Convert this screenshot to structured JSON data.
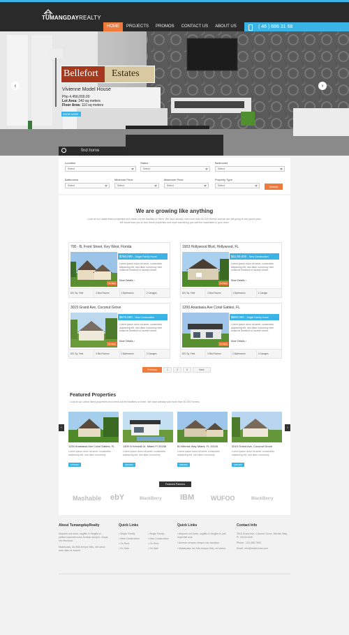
{
  "brand": {
    "name_bold": "TUMANGDAY",
    "name_light": "REALTY"
  },
  "nav": {
    "items": [
      "HOME",
      "PROJECTS",
      "PROMOS",
      "CONTACT US",
      "ABOUT US"
    ],
    "active": 0
  },
  "phone": "( 46 ) 686 31 68",
  "hero": {
    "banner_left": "Bellefort",
    "banner_right": "Estates",
    "title": "Vivienne Model House",
    "price": "Php 4,456,000.00",
    "lot_label": "Lot Area:",
    "lot_value": "140 sq meters",
    "floor_label": "Floor Area:",
    "floor_value": "110 sq meters",
    "button": "KNOW MORE",
    "find": "find home"
  },
  "search": {
    "fields": [
      {
        "label": "Location",
        "value": "Select"
      },
      {
        "label": "Status",
        "value": "Select"
      },
      {
        "label": "Bedrooms",
        "value": "Select"
      },
      {
        "label": "Bathrooms",
        "value": "Select"
      },
      {
        "label": "Minimum Price",
        "value": "Select"
      },
      {
        "label": "Maximum Price",
        "value": "Select"
      },
      {
        "label": "Property Type",
        "value": "Select"
      }
    ],
    "button": "Search"
  },
  "growth": {
    "title": "We are growing like anything",
    "text": "Look at our Latest listed properties and check out the facilities on them. We have already sold more than 50,000 Homes and we are still going at very good pace. We would love you to look these properties and hope something you will find matchable to your need."
  },
  "listings": [
    {
      "title": "700 - B, Front Street, Key West, Florida",
      "price": "$750,000",
      "type": "Single Family Home",
      "desc": "Lorem ipsum dolor sit amet, consectetu adipiscing elit, sed diam nonummy nibh euismod tincidunt ut laoreet dolore",
      "more": "More Details",
      "sale": "On Sale",
      "stats": [
        "821 Sq. Feet",
        "3 Bed Rooms",
        "2 Bathrooms",
        "2 Garages"
      ]
    },
    {
      "title": "1903 Hollywood Blvd, Hollywood, FL",
      "price": "$11,50,000",
      "type": "New Construction",
      "desc": "Lorem ipsum dolor sit amet, consectetu adipiscing elit, sed diam nonummy nibh euismod tincidunt ut laoreet dolore",
      "more": "More Details",
      "sale": "On Sale",
      "stats": [
        "821 Sq. Feet",
        "3 Bed Rooms",
        "2 Bathrooms",
        "1 Garage"
      ]
    },
    {
      "title": "3015 Grand Ave, Coconut Grove",
      "price": "$570,000",
      "type": "New Construction",
      "desc": "Lorem ipsum dolor sit amet, consectetu adipiscing elit, sed diam nonummy nibh euismod tincidunt ut laoreet dolore",
      "more": "More Details",
      "sale": "On Sale",
      "stats": [
        "821 Sq. Feet",
        "3 Bed Rooms",
        "2 Bathrooms",
        "3 Garages"
      ]
    },
    {
      "title": "1200 Anastasia Ave Coral Gables, FL",
      "price": "$500,000",
      "type": "Single Family Home",
      "desc": "Lorem ipsum dolor sit amet, consectetu adipiscing elit, sed diam nonummy nibh euismod tincidunt ut laoreet dolore",
      "more": "More Details",
      "sale": "On Sale",
      "stats": [
        "821 Sq. Feet",
        "3 Bed Rooms",
        "2 Bathrooms",
        "2 Garages"
      ]
    }
  ],
  "pager": {
    "prev": "Previous",
    "pages": [
      "1",
      "2",
      "3"
    ],
    "next": "Next"
  },
  "featured": {
    "title": "Featured Properties",
    "text": "Look at our Latest listed properties and check out the facilities on them, We have already sold more than 50,000 Homes.",
    "items": [
      {
        "title": "1200 Anastasia Ave Coral Gables, FL",
        "desc": "Lorem ipsum dolor sit amet, consectetu adipiscing elit, sed diam nonummy",
        "price": "$750000"
      },
      {
        "title": "1400 N Kendall Dr, Miami Fl 33156",
        "desc": "Lorem ipsum dolor sit amet, consectetu adipiscing elit, sed diam nonummy",
        "price": "$650000"
      },
      {
        "title": "60 Merrick Way Miami, FL 33134",
        "desc": "Lorem ipsum dolor sit amet, consectetu adipiscing elit, sed diam nonummy",
        "price": "$850000"
      },
      {
        "title": "3015 Grand Ave, Coconut Grove",
        "desc": "Lorem ipsum dolor sit amet, consectetu adipiscing elit, sed diam nonummy",
        "price": "$950000"
      }
    ]
  },
  "partners": {
    "tag": "Featured Partners",
    "logos": [
      "Mashable",
      "ebY",
      "BlackBerry",
      "IBM",
      "WUFOO",
      "BlackBerry"
    ]
  },
  "footer": {
    "about": {
      "title": "About TumangdayRealty",
      "text1": "Aliquam orci tortor, sagittis in fringilla in, pellent imperdiet erat. Aenean semper, neque nec tincidunt.",
      "text2": "Malesuada, dui felis tempor felis, vel varius ante diam et mauris."
    },
    "quick1": {
      "title": "Quick Links",
      "col1": [
        "Single Family",
        "New Construction",
        "On Rent",
        "On Sale"
      ],
      "col2": [
        "Single Family",
        "New Construction",
        "On Rent",
        "On Sale"
      ]
    },
    "quick2": {
      "title": "Quick Links",
      "items": [
        "Aliquam orci tortor, sagittis in fringilla in, pell imperdiet erat.",
        "Aenean semper, tempor nec faucibus.",
        "Malesuada, dui felis tempor felis, vel varius."
      ]
    },
    "contact": {
      "title": "Contact Info",
      "address": "3015 Grand Ave, Coconut Grove, Merrick Way, FL 33134 USA",
      "phone": "Phone : 123-456-7890",
      "email": "Email : info@tradhomes.com"
    }
  },
  "colors": {
    "accent_blue": "#3ab4e6",
    "accent_orange": "#f07a3a",
    "header": "#2a2a2a"
  }
}
